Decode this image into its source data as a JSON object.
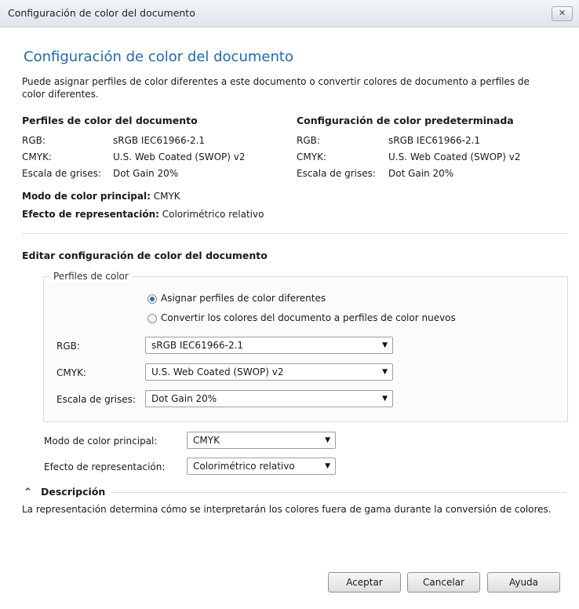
{
  "window": {
    "title": "Configuración de color del documento",
    "close_label": "✕"
  },
  "heading": "Configuración de color del documento",
  "intro": "Puede asignar perfiles de color diferentes a este documento o convertir colores de documento a perfiles de color diferentes.",
  "doc_profiles": {
    "title": "Perfiles de color del documento",
    "rgb_label": "RGB:",
    "rgb_value": "sRGB IEC61966-2.1",
    "cmyk_label": "CMYK:",
    "cmyk_value": "U.S. Web Coated (SWOP) v2",
    "gray_label": "Escala de grises:",
    "gray_value": "Dot Gain 20%"
  },
  "default_profiles": {
    "title": "Configuración de color predeterminada",
    "rgb_label": "RGB:",
    "rgb_value": "sRGB IEC61966-2.1",
    "cmyk_label": "CMYK:",
    "cmyk_value": "U.S. Web Coated (SWOP) v2",
    "gray_label": "Escala de grises:",
    "gray_value": "Dot Gain 20%"
  },
  "summary": {
    "mode_label": "Modo de color principal:",
    "mode_value": "CMYK",
    "intent_label": "Efecto de representación:",
    "intent_value": "Colorimétrico relativo"
  },
  "edit": {
    "title": "Editar configuración de color del documento",
    "group_label": "Perfiles de color",
    "radio_assign": "Asignar perfiles de color diferentes",
    "radio_convert": "Convertir los colores del documento a perfiles de color nuevos",
    "radio_selected": "assign",
    "rgb_label": "RGB:",
    "rgb_value": "sRGB IEC61966-2.1",
    "cmyk_label": "CMYK:",
    "cmyk_value": "U.S. Web Coated (SWOP) v2",
    "gray_label": "Escala de grises:",
    "gray_value": "Dot Gain 20%",
    "mode_label": "Modo de color principal:",
    "mode_value": "CMYK",
    "intent_label": "Efecto de representación:",
    "intent_value": "Colorimétrico relativo"
  },
  "description": {
    "title": "Descripción",
    "toggle_icon": "⌃",
    "text": "La representación determina cómo se interpretarán los colores fuera de gama durante la conversión de colores."
  },
  "buttons": {
    "ok": "Aceptar",
    "cancel": "Cancelar",
    "help": "Ayuda"
  },
  "colors": {
    "heading": "#1f68b5",
    "radio_dot": "#3b6fb0"
  }
}
